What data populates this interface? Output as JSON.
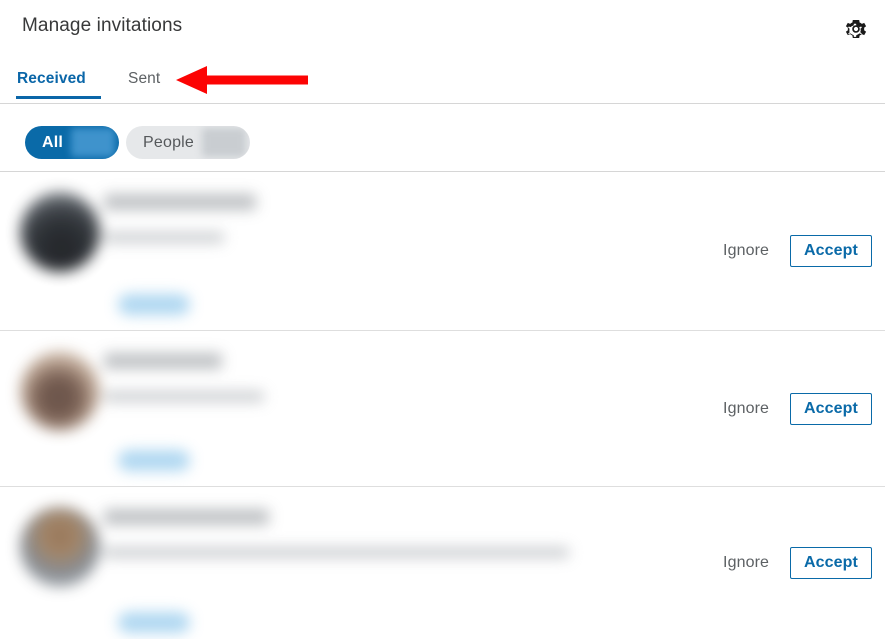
{
  "header": {
    "title": "Manage invitations",
    "settings_icon": "gear-icon",
    "settings_label": "Settings"
  },
  "tabs": [
    {
      "id": "received",
      "label": "Received",
      "active": true
    },
    {
      "id": "sent",
      "label": "Sent",
      "active": false
    }
  ],
  "filters": [
    {
      "id": "all",
      "label": "All",
      "selected": true,
      "count": ""
    },
    {
      "id": "people",
      "label": "People",
      "selected": false,
      "count": ""
    }
  ],
  "invitations": [
    {
      "ignore_label": "Ignore",
      "accept_label": "Accept"
    },
    {
      "ignore_label": "Ignore",
      "accept_label": "Accept"
    },
    {
      "ignore_label": "Ignore",
      "accept_label": "Accept"
    }
  ],
  "annotation": {
    "type": "red-left-arrow",
    "points_to": "Sent",
    "color": "#fc0404"
  },
  "colors": {
    "accent_blue": "#0a66a8",
    "pill_selected_bg": "#0a6aa8",
    "pill_unselected_bg": "#e6e8ea",
    "text_primary": "#38393a",
    "text_secondary": "#5d6164",
    "divider": "#d6d6d6",
    "annotation_red": "#fc0404"
  }
}
